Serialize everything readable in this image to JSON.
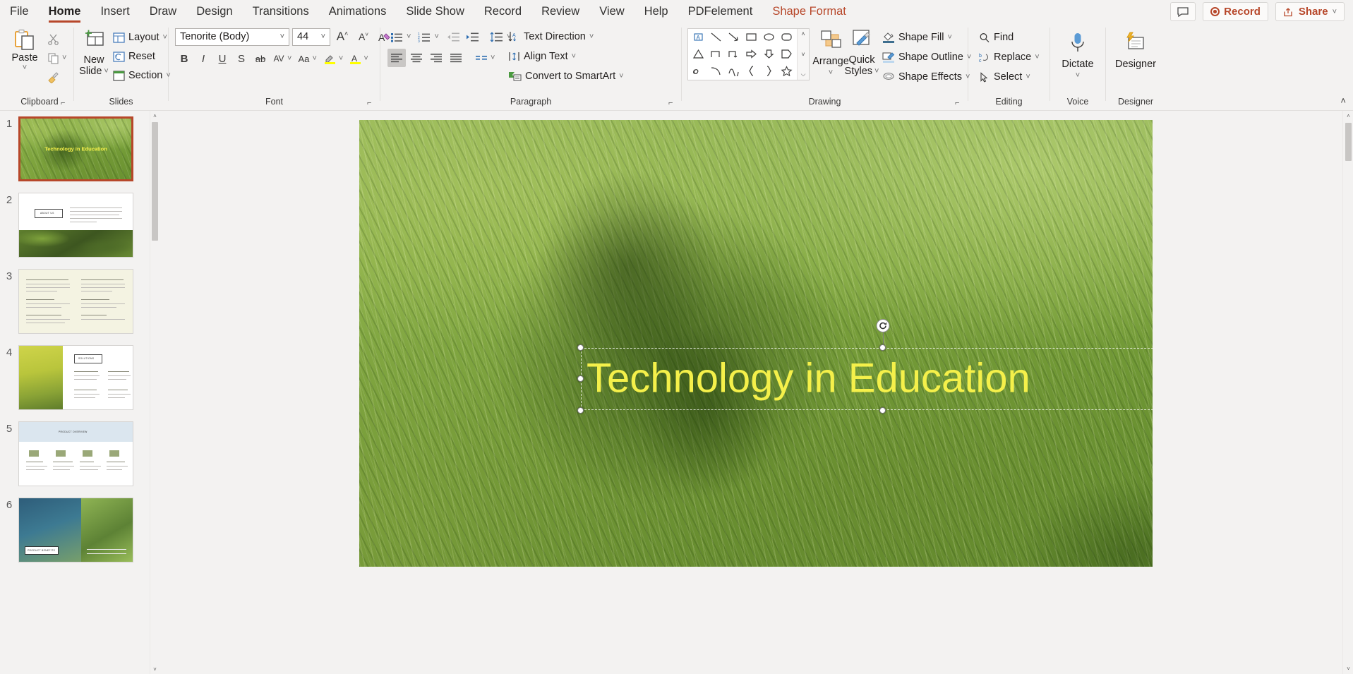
{
  "tabs": [
    {
      "label": "File",
      "state": "normal"
    },
    {
      "label": "Home",
      "state": "active"
    },
    {
      "label": "Insert",
      "state": "normal"
    },
    {
      "label": "Draw",
      "state": "normal"
    },
    {
      "label": "Design",
      "state": "normal"
    },
    {
      "label": "Transitions",
      "state": "normal"
    },
    {
      "label": "Animations",
      "state": "normal"
    },
    {
      "label": "Slide Show",
      "state": "normal"
    },
    {
      "label": "Record",
      "state": "normal"
    },
    {
      "label": "Review",
      "state": "normal"
    },
    {
      "label": "View",
      "state": "normal"
    },
    {
      "label": "Help",
      "state": "normal"
    },
    {
      "label": "PDFelement",
      "state": "normal"
    },
    {
      "label": "Shape Format",
      "state": "contextual"
    }
  ],
  "titlebar_right": {
    "comments_icon": "comment-icon",
    "record_label": "Record",
    "share_label": "Share",
    "share_chevron": "˅"
  },
  "ribbon": {
    "groups": [
      {
        "name": "Clipboard",
        "label": "Clipboard",
        "has_launcher": true
      },
      {
        "name": "Slides",
        "label": "Slides",
        "has_launcher": false
      },
      {
        "name": "Font",
        "label": "Font",
        "has_launcher": true
      },
      {
        "name": "Paragraph",
        "label": "Paragraph",
        "has_launcher": true
      },
      {
        "name": "Drawing",
        "label": "Drawing",
        "has_launcher": true
      },
      {
        "name": "Editing",
        "label": "Editing",
        "has_launcher": false
      },
      {
        "name": "Voice",
        "label": "Voice",
        "has_launcher": false
      },
      {
        "name": "Designer",
        "label": "Designer",
        "has_launcher": false
      }
    ],
    "clipboard": {
      "paste_label": "Paste",
      "paste_chevron": "˅",
      "cut_icon": "scissors-icon",
      "copy_icon": "copy-icon",
      "copy_chevron": "˅",
      "format_painter_icon": "format-painter-icon"
    },
    "slides": {
      "new_slide_line1": "New",
      "new_slide_line2": "Slide",
      "new_slide_chevron": "˅",
      "layout_label": "Layout",
      "layout_chevron": "˅",
      "reset_label": "Reset",
      "section_label": "Section",
      "section_chevron": "˅"
    },
    "font": {
      "font_name": "Tenorite  (Body)",
      "font_size": "44",
      "dropdown_chevron": "˅",
      "grow_font_icon": "grow-font-icon",
      "shrink_font_icon": "shrink-font-icon",
      "clear_formatting_icon": "clear-formatting-icon",
      "bold_label": "B",
      "italic_label": "I",
      "underline_label": "U",
      "shadow_label": "S",
      "strikethrough_label": "ab",
      "char_spacing_label": "AV",
      "change_case_label": "Aa",
      "highlight_icon": "text-highlight-icon",
      "font_color_label": "A"
    },
    "paragraph": {
      "bullets_icon": "bullets-icon",
      "numbering_icon": "numbering-icon",
      "decrease_indent_icon": "decrease-indent-icon",
      "increase_indent_icon": "increase-indent-icon",
      "line_spacing_icon": "line-spacing-icon",
      "align_left_icon": "align-left-icon",
      "align_center_icon": "align-center-icon",
      "align_right_icon": "align-right-icon",
      "justify_icon": "justify-icon",
      "columns_icon": "columns-icon",
      "text_direction_label": "Text Direction",
      "align_text_label": "Align Text",
      "convert_smartart_label": "Convert to SmartArt",
      "chevron": "˅"
    },
    "drawing": {
      "shapes": [
        "textbox-shape",
        "line-shape",
        "arrow-shape",
        "rectangle-shape",
        "oval-shape",
        "rounded-rect-shape",
        "triangle-shape",
        "elbow-connector-shape",
        "elbow-arrow-shape",
        "right-arrow-shape",
        "down-arrow-shape",
        "pentagon-shape",
        "scribble-shape",
        "arc-shape",
        "curve-shape",
        "left-brace-shape",
        "right-brace-shape",
        "star-shape"
      ],
      "gallery_up": "˄",
      "gallery_down": "˅",
      "gallery_more": "⌵",
      "arrange_label": "Arrange",
      "arrange_chevron": "˅",
      "quick_styles_line1": "Quick",
      "quick_styles_line2": "Styles",
      "quick_styles_chevron": "˅",
      "shape_fill_label": "Shape Fill",
      "shape_outline_label": "Shape Outline",
      "shape_effects_label": "Shape Effects",
      "chevron": "˅"
    },
    "editing": {
      "find_label": "Find",
      "replace_label": "Replace",
      "select_label": "Select",
      "chevron": "˅"
    },
    "voice": {
      "dictate_label": "Dictate",
      "dictate_chevron": "˅",
      "mic_icon": "microphone-icon"
    },
    "designer": {
      "designer_label": "Designer",
      "designer_icon": "designer-icon"
    },
    "collapse_icon": "˄"
  },
  "thumbnails": [
    {
      "number": "1",
      "selected": true,
      "kind": "title-photo",
      "title": "Technology in Education"
    },
    {
      "number": "2",
      "selected": false,
      "kind": "about-us",
      "title": "ABOUT US"
    },
    {
      "number": "3",
      "selected": false,
      "kind": "text-grid",
      "title": ""
    },
    {
      "number": "4",
      "selected": false,
      "kind": "solutions",
      "title": "SOLUTIONS"
    },
    {
      "number": "5",
      "selected": false,
      "kind": "overview",
      "title": "PRODUCT OVERVIEW"
    },
    {
      "number": "6",
      "selected": false,
      "kind": "benefits",
      "title": "PRODUCT BENEFITS"
    }
  ],
  "slide": {
    "title_text": "Technology in Education",
    "title_color": "#f5f04a",
    "selection": {
      "rotate_handle_icon": "rotate-handle-icon",
      "handle_positions": [
        "top-left",
        "top-center",
        "top-right",
        "middle-left",
        "middle-right",
        "bottom-left",
        "bottom-center",
        "bottom-right"
      ]
    }
  },
  "scrollbars": {
    "up_arrow": "˄",
    "down_arrow": "˅"
  },
  "colors": {
    "accent": "#b7472a",
    "selection_border": "#b7472a",
    "ribbon_bg": "#f3f2f1",
    "title_yellow": "#f5f04a"
  }
}
